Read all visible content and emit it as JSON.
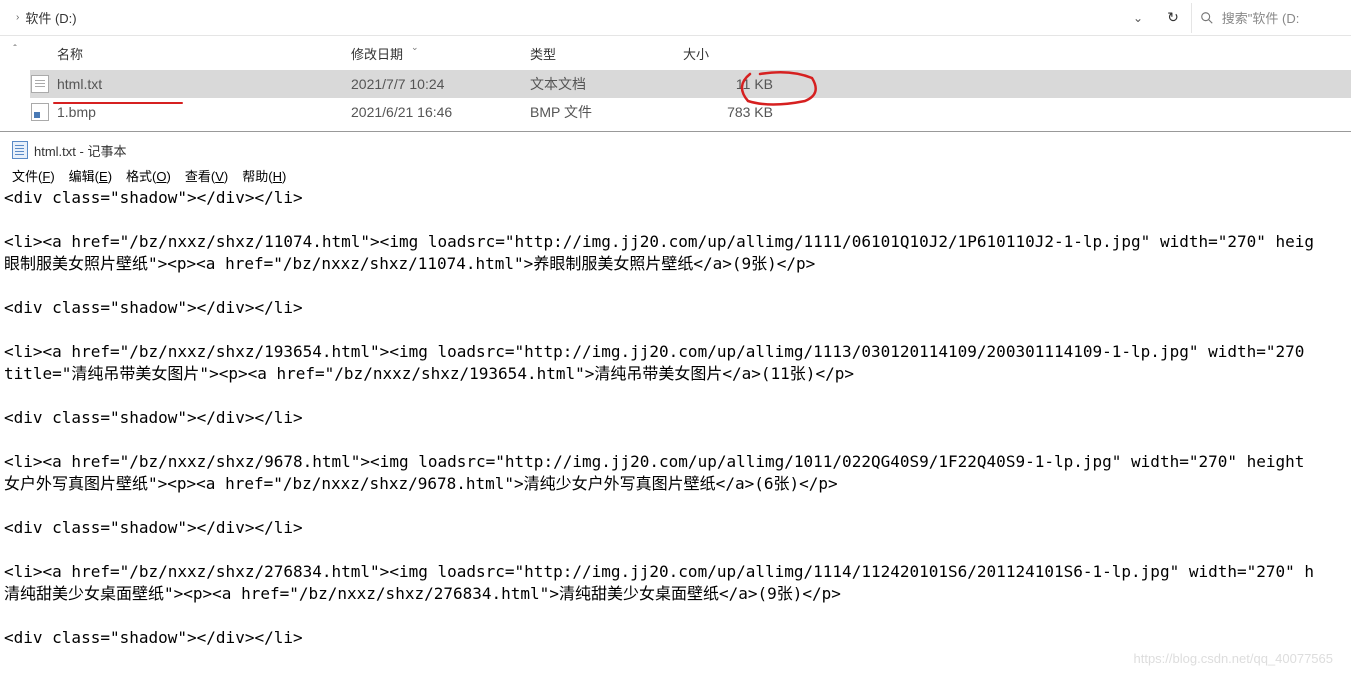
{
  "explorer": {
    "breadcrumb": "软件 (D:)",
    "search_placeholder": "搜索\"软件 (D:",
    "columns": {
      "name": "名称",
      "date": "修改日期",
      "type": "类型",
      "size": "大小"
    },
    "files": [
      {
        "name": "html.txt",
        "date": "2021/7/7 10:24",
        "type": "文本文档",
        "size": "11 KB",
        "icon": "text",
        "selected": true
      },
      {
        "name": "1.bmp",
        "date": "2021/6/21 16:46",
        "type": "BMP 文件",
        "size": "783 KB",
        "icon": "bmp",
        "selected": false
      }
    ]
  },
  "notepad": {
    "title": "html.txt - 记事本",
    "menus": {
      "file": {
        "label": "文件",
        "key": "F"
      },
      "edit": {
        "label": "编辑",
        "key": "E"
      },
      "format": {
        "label": "格式",
        "key": "O"
      },
      "view": {
        "label": "查看",
        "key": "V"
      },
      "help": {
        "label": "帮助",
        "key": "H"
      }
    },
    "content": "<div class=\"shadow\"></div></li>\n\n<li><a href=\"/bz/nxxz/shxz/11074.html\"><img loadsrc=\"http://img.jj20.com/up/allimg/1111/06101Q10J2/1P610110J2-1-lp.jpg\" width=\"270\" heig\n眼制服美女照片壁纸\"><p><a href=\"/bz/nxxz/shxz/11074.html\">养眼制服美女照片壁纸</a>(9张)</p>\n\n<div class=\"shadow\"></div></li>\n\n<li><a href=\"/bz/nxxz/shxz/193654.html\"><img loadsrc=\"http://img.jj20.com/up/allimg/1113/030120114109/200301114109-1-lp.jpg\" width=\"270\ntitle=\"清纯吊带美女图片\"><p><a href=\"/bz/nxxz/shxz/193654.html\">清纯吊带美女图片</a>(11张)</p>\n\n<div class=\"shadow\"></div></li>\n\n<li><a href=\"/bz/nxxz/shxz/9678.html\"><img loadsrc=\"http://img.jj20.com/up/allimg/1011/022QG40S9/1F22Q40S9-1-lp.jpg\" width=\"270\" height\n女户外写真图片壁纸\"><p><a href=\"/bz/nxxz/shxz/9678.html\">清纯少女户外写真图片壁纸</a>(6张)</p>\n\n<div class=\"shadow\"></div></li>\n\n<li><a href=\"/bz/nxxz/shxz/276834.html\"><img loadsrc=\"http://img.jj20.com/up/allimg/1114/112420101S6/201124101S6-1-lp.jpg\" width=\"270\" h\n清纯甜美少女桌面壁纸\"><p><a href=\"/bz/nxxz/shxz/276834.html\">清纯甜美少女桌面壁纸</a>(9张)</p>\n\n<div class=\"shadow\"></div></li>"
  },
  "watermark": "https://blog.csdn.net/qq_40077565"
}
